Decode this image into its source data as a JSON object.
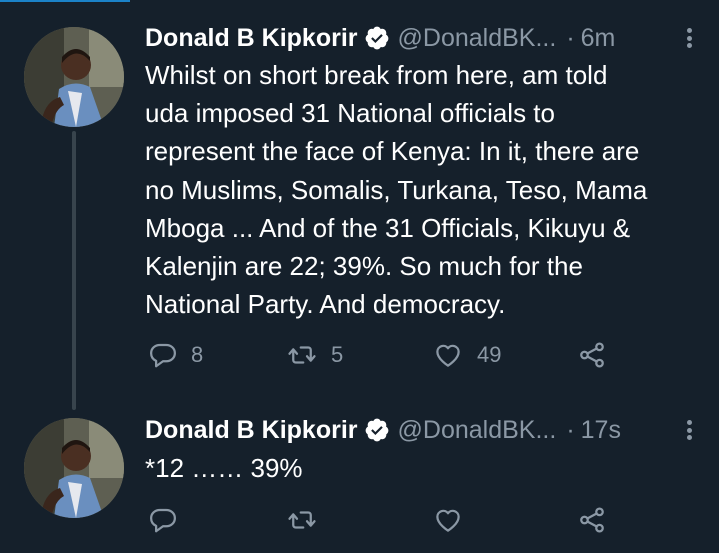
{
  "tweets": [
    {
      "name": "Donald B Kipkorir",
      "handle": "@DonaldBK...",
      "dot": "·",
      "time": "6m",
      "text": "Whilst on short break from here, am told\nuda imposed 31 National officials to\nrepresent the face of Kenya: In it, there are\nno Muslims, Somalis, Turkana, Teso, Mama\nMboga ... And of the 31 Officials, Kikuyu &\nKalenjin are 22; 39%. So much for the\nNational Party. And democracy.",
      "replies": "8",
      "retweets": "5",
      "likes": "49"
    },
    {
      "name": "Donald B Kipkorir",
      "handle": "@DonaldBK...",
      "dot": "·",
      "time": "17s",
      "text": "*12 …… 39%",
      "replies": "",
      "retweets": "",
      "likes": ""
    }
  ],
  "icons": {
    "verified": "verified-badge-icon",
    "more": "more-vertical-icon",
    "reply": "reply-icon",
    "retweet": "retweet-icon",
    "like": "heart-icon",
    "share": "share-icon"
  },
  "colors": {
    "background": "#15202b",
    "secondary_text": "#8b98a5",
    "thread_line": "#38444d"
  }
}
